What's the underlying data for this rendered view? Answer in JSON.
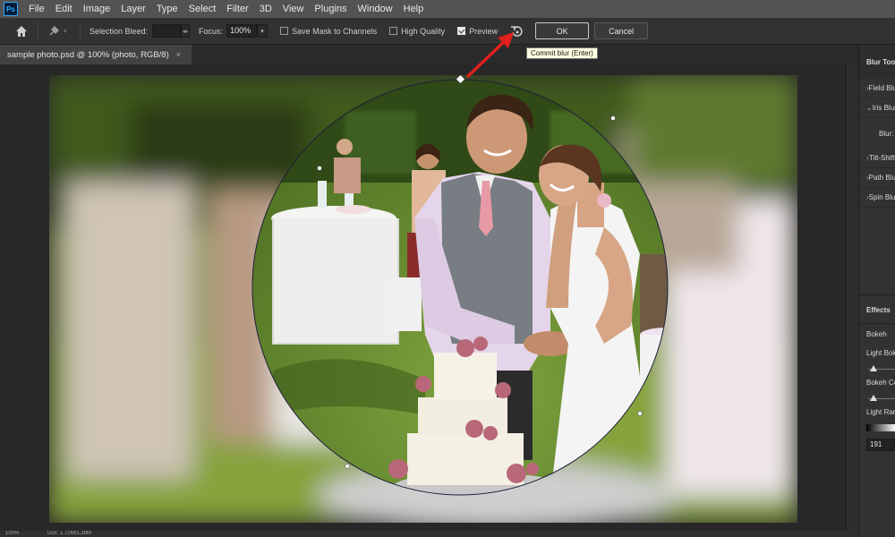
{
  "menu": [
    "File",
    "Edit",
    "Image",
    "Layer",
    "Type",
    "Select",
    "Filter",
    "3D",
    "View",
    "Plugins",
    "Window",
    "Help"
  ],
  "options": {
    "selection_bleed_label": "Selection Bleed:",
    "focus_label": "Focus:",
    "focus_value": "100%",
    "save_mask_label": "Save Mask to Channels",
    "save_mask_checked": false,
    "high_quality_label": "High Quality",
    "high_quality_checked": false,
    "preview_label": "Preview",
    "preview_checked": true,
    "ok_label": "OK",
    "cancel_label": "Cancel"
  },
  "tooltip": "Commit blur (Enter)",
  "document_tab": {
    "title": "sample photo.psd @ 100% (photo, RGB/8)",
    "close": "×"
  },
  "panel": {
    "title": "Blur Tools",
    "items": [
      {
        "label": "Field Blur",
        "expanded": false
      },
      {
        "label": "Iris Blur",
        "expanded": true
      },
      {
        "label": "Tilt-Shift",
        "expanded": false
      },
      {
        "label": "Path Blur",
        "expanded": false
      },
      {
        "label": "Spin Blur",
        "expanded": false
      }
    ],
    "iris_blur_sub": "Blur:",
    "effects_title": "Effects",
    "bokeh_label": "Bokeh",
    "light_bokeh_label": "Light Bokeh",
    "bokeh_color_label": "Bokeh Color",
    "light_range_label": "Light Range",
    "light_range_value": "191"
  },
  "status": {
    "zoom": "100%",
    "doc": "Doc: 1.72M/1.28M"
  },
  "colors": {
    "accent_arrow": "#e0201c",
    "menubar": "#535353",
    "options_bar": "#323232",
    "canvas_bg": "#282828"
  },
  "icons": {
    "home": "home-icon",
    "tool": "blur-tool-icon",
    "reset": "reset-icon",
    "pin_arrow": "red-arrow-icon"
  }
}
